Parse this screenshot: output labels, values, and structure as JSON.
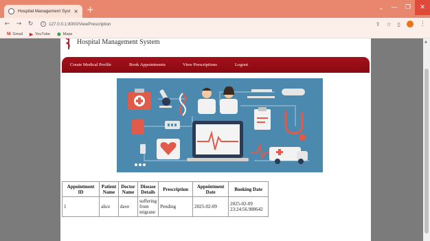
{
  "browser": {
    "tab_title": "Hospital Management System",
    "tab_close": "×",
    "new_tab": "+",
    "url": "127.0.0.1:8000/ViewPrescription",
    "bookmarks": [
      {
        "label": "Gmail",
        "icon": "gmail-icon",
        "color": "#d93025"
      },
      {
        "label": "YouTube",
        "icon": "youtube-icon",
        "color": "#e21b1b"
      },
      {
        "label": "Maps",
        "icon": "maps-icon",
        "color": "#34a853"
      }
    ]
  },
  "site": {
    "brand": "Hospital Management System",
    "brand_color": "#a3101a",
    "nav": {
      "create_profile": "Create Medical Profile",
      "book": "Book Appointments",
      "view": "View Prescriptions",
      "logout": "Logout"
    }
  },
  "table": {
    "headers": {
      "appointment_id": "Appointment ID",
      "patient_name": "Patient Name",
      "doctor_name": "Doctor Name",
      "disease_details": "Disease Details",
      "prescription": "Prescription",
      "appointment_date": "Appointment Date",
      "booking_date": "Booking Date"
    },
    "rows": [
      {
        "appointment_id": "1",
        "patient_name": "alice",
        "doctor_name": "dave",
        "disease_details": "suffering from migrane",
        "prescription": "Pending",
        "appointment_date": "2025-02-09",
        "booking_date": "2025-02-09 23:24:56.988642"
      }
    ]
  }
}
